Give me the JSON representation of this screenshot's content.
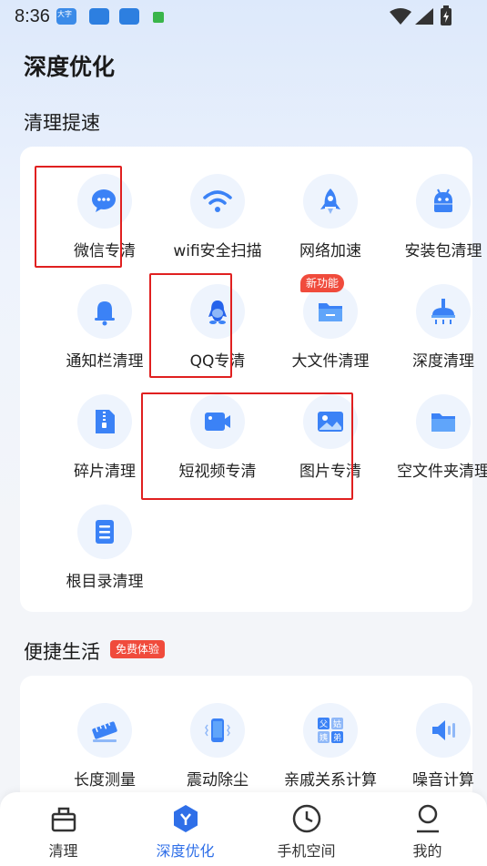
{
  "status_bar": {
    "time": "8:36",
    "notification_label": "大字"
  },
  "page_title": "深度优化",
  "section_clean": {
    "title": "清理提速",
    "items": [
      {
        "label": "微信专清",
        "icon": "wechat-icon"
      },
      {
        "label": "wifi安全扫描",
        "icon": "wifi-icon"
      },
      {
        "label": "网络加速",
        "icon": "rocket-icon"
      },
      {
        "label": "安装包清理",
        "icon": "android-icon"
      },
      {
        "label": "通知栏清理",
        "icon": "bell-icon"
      },
      {
        "label": "QQ专清",
        "icon": "qq-icon"
      },
      {
        "label": "大文件清理",
        "icon": "folder-icon"
      },
      {
        "label": "深度清理",
        "icon": "brush-icon"
      },
      {
        "label": "碎片清理",
        "icon": "zip-file-icon"
      },
      {
        "label": "短视频专清",
        "icon": "video-icon"
      },
      {
        "label": "图片专清",
        "icon": "image-icon"
      },
      {
        "label": "空文件夹清理",
        "icon": "empty-folder-icon"
      },
      {
        "label": "根目录清理",
        "icon": "document-icon"
      }
    ],
    "new_badge": "新功能"
  },
  "section_life": {
    "title": "便捷生活",
    "badge": "免费体验",
    "items": [
      {
        "label": "长度测量",
        "icon": "ruler-icon"
      },
      {
        "label": "震动除尘",
        "icon": "phone-vibrate-icon"
      },
      {
        "label": "亲戚关系计算",
        "icon": "relatives-icon"
      },
      {
        "label": "噪音计算",
        "icon": "speaker-icon"
      }
    ],
    "relatives_glyphs": [
      "父",
      "姑",
      "姨",
      "弟"
    ]
  },
  "tabbar": {
    "tabs": [
      {
        "label": "清理",
        "icon": "clean-bag-icon"
      },
      {
        "label": "深度优化",
        "icon": "optimize-icon",
        "active": true
      },
      {
        "label": "手机空间",
        "icon": "clock-icon"
      },
      {
        "label": "我的",
        "icon": "profile-icon"
      }
    ]
  },
  "colors": {
    "accent": "#2f6fe8",
    "icon_blue": "#3b82f6",
    "badge_red": "#f04b3c",
    "highlight_box": "#e02020"
  }
}
